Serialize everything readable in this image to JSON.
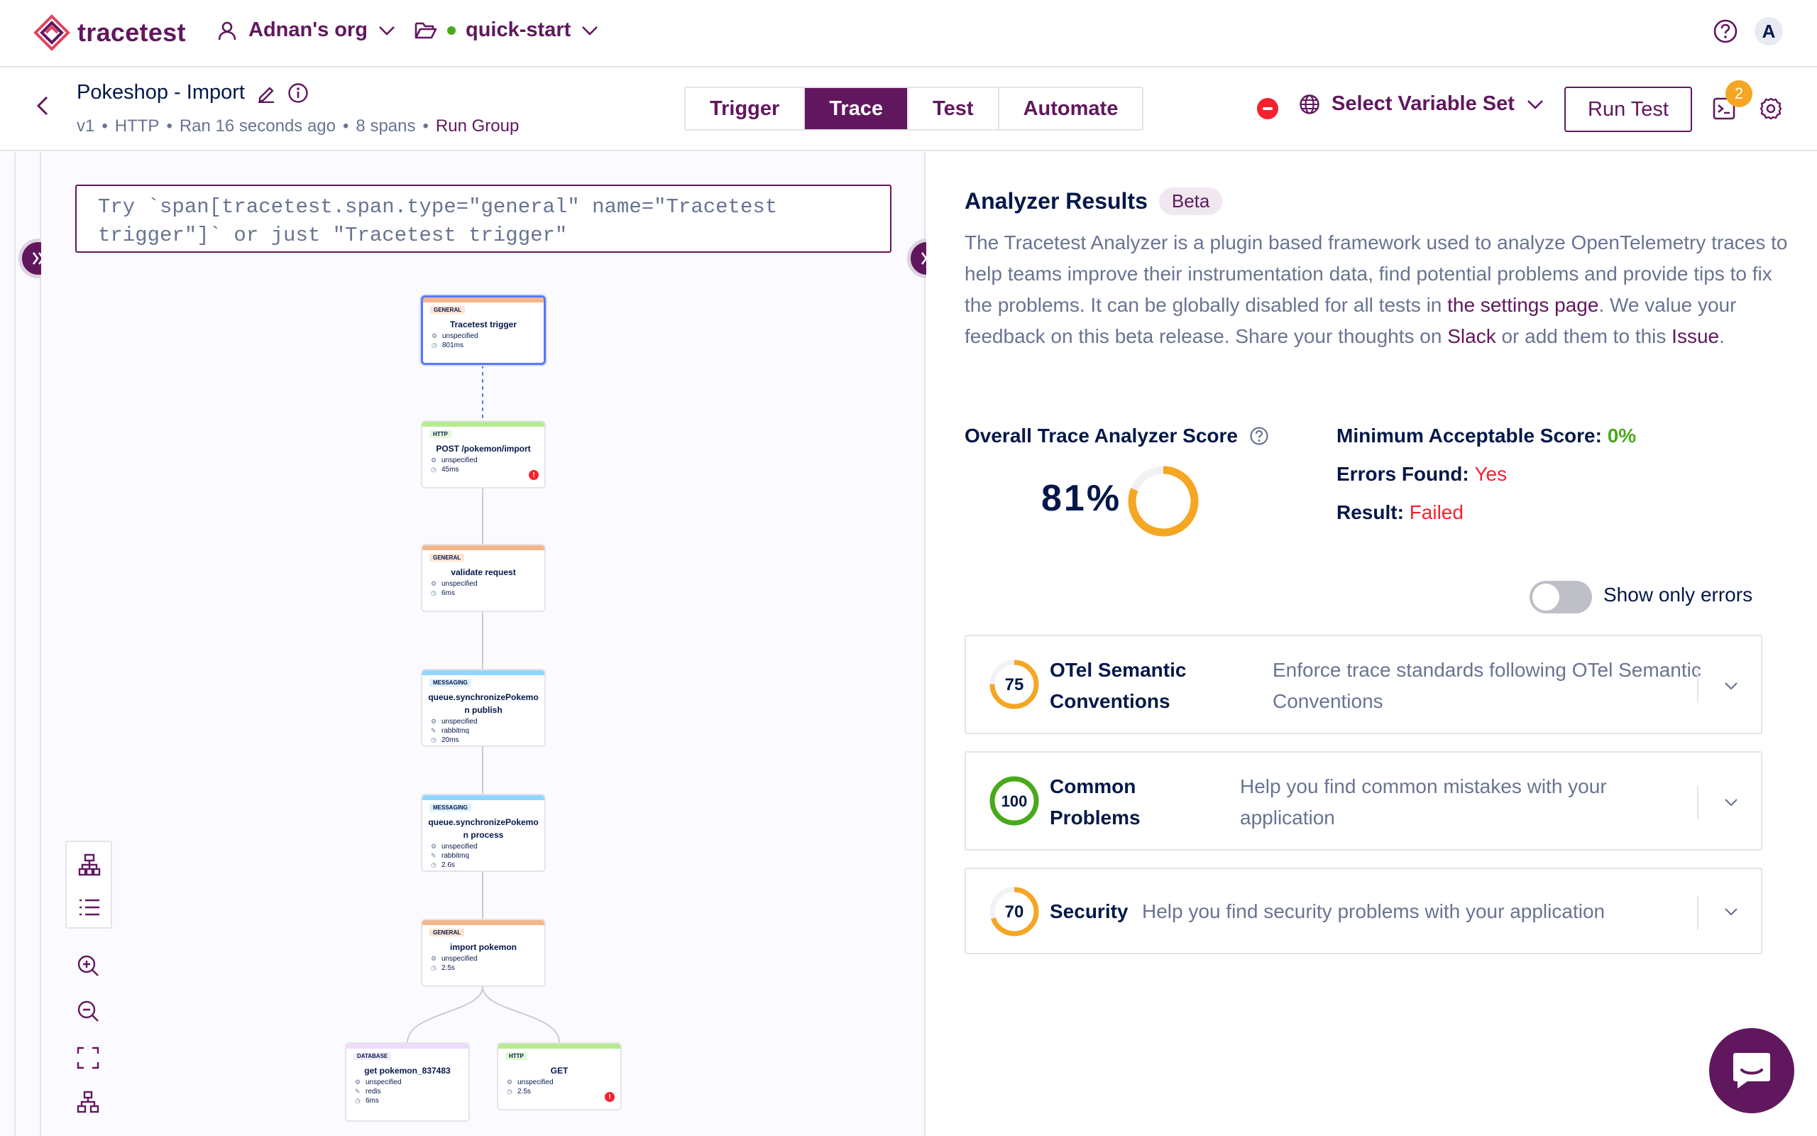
{
  "topbar": {
    "brand": "tracetest",
    "org": "Adnan's org",
    "environment": "quick-start",
    "avatar_initial": "A"
  },
  "header": {
    "test_name": "Pokeshop - Import",
    "meta": {
      "version": "v1",
      "trigger_type": "HTTP",
      "ran": "Ran 16 seconds ago",
      "spans": "8 spans",
      "run_group": "Run Group",
      "sep": "•"
    },
    "tabs": [
      {
        "label": "Trigger",
        "active": false
      },
      {
        "label": "Trace",
        "active": true
      },
      {
        "label": "Test",
        "active": false
      },
      {
        "label": "Automate",
        "active": false
      }
    ],
    "variable_set_label": "Select Variable Set",
    "run_test_label": "Run Test",
    "terminal_badge": "2"
  },
  "trace": {
    "selector_placeholder": "Try `span[tracetest.span.type=\"general\" name=\"Tracetest trigger\"]` or just \"Tracetest trigger\"",
    "nodes": [
      {
        "type": "GENERAL",
        "name": "Tracetest trigger",
        "service": "unspecified",
        "system": "",
        "duration": "801ms",
        "error": false,
        "selected": true,
        "color": "#f6b68b",
        "badge": "#fde4d2"
      },
      {
        "type": "HTTP",
        "name": "POST /pokemon/import",
        "service": "unspecified",
        "system": "",
        "duration": "45ms",
        "error": true,
        "selected": false,
        "color": "#b7eb8f",
        "badge": "#e4f7d6"
      },
      {
        "type": "GENERAL",
        "name": "validate request",
        "service": "unspecified",
        "system": "",
        "duration": "6ms",
        "error": false,
        "selected": false,
        "color": "#f6b68b",
        "badge": "#fde4d2"
      },
      {
        "type": "MESSAGING",
        "name": "queue.synchronizePokemon publish",
        "service": "unspecified",
        "system": "rabbitmq",
        "duration": "20ms",
        "error": false,
        "selected": false,
        "color": "#91d5ff",
        "badge": "#dcf0fd"
      },
      {
        "type": "MESSAGING",
        "name": "queue.synchronizePokemon process",
        "service": "unspecified",
        "system": "rabbitmq",
        "duration": "2.6s",
        "error": false,
        "selected": false,
        "color": "#91d5ff",
        "badge": "#dcf0fd"
      },
      {
        "type": "GENERAL",
        "name": "import pokemon",
        "service": "unspecified",
        "system": "",
        "duration": "2.5s",
        "error": false,
        "selected": false,
        "color": "#f6b68b",
        "badge": "#fde4d2"
      },
      {
        "type": "DATABASE",
        "name": "get pokemon_837483",
        "service": "unspecified",
        "system": "redis",
        "duration": "6ms",
        "error": false,
        "selected": false,
        "color": "#efdbff",
        "badge": "#f6ebff"
      },
      {
        "type": "HTTP",
        "name": "GET",
        "service": "unspecified",
        "system": "",
        "duration": "2.5s",
        "error": true,
        "selected": false,
        "color": "#b7eb8f",
        "badge": "#e4f7d6"
      }
    ]
  },
  "analyzer": {
    "title": "Analyzer Results",
    "beta": "Beta",
    "desc": {
      "p1": "The Tracetest Analyzer is a plugin based framework used to analyze OpenTelemetry traces to help teams improve their instrumentation data, find potential problems and provide tips to fix the problems. It can be globally disabled for all tests in ",
      "link1": "the settings page",
      "p2": ". We value your feedback on this beta release. Share your thoughts on ",
      "link2": "Slack",
      "p3": " or add them to this ",
      "link3": "Issue",
      "p4": "."
    },
    "score_label": "Overall Trace Analyzer Score",
    "score": 81,
    "score_text": "81%",
    "min_score_label": "Minimum Acceptable Score:",
    "min_score_value": "0%",
    "errors_label": "Errors Found:",
    "errors_value": "Yes",
    "result_label": "Result:",
    "result_value": "Failed",
    "toggle_label": "Show only errors",
    "toggle_on": false,
    "plugins": [
      {
        "score": 75,
        "score_text": "75",
        "name": "OTel Semantic Conventions",
        "desc": "Enforce trace standards following OTel Semantic Conventions"
      },
      {
        "score": 100,
        "score_text": "100",
        "name": "Common Problems",
        "desc": "Help you find common mistakes with your application"
      },
      {
        "score": 70,
        "score_text": "70",
        "name": "Security",
        "desc": "Help you find security problems with your application"
      }
    ]
  },
  "colors": {
    "brand": "#61175e",
    "warning": "#f5a623",
    "success": "#49aa19",
    "error": "#f5222d",
    "text": "#031849",
    "muted": "#687492"
  }
}
